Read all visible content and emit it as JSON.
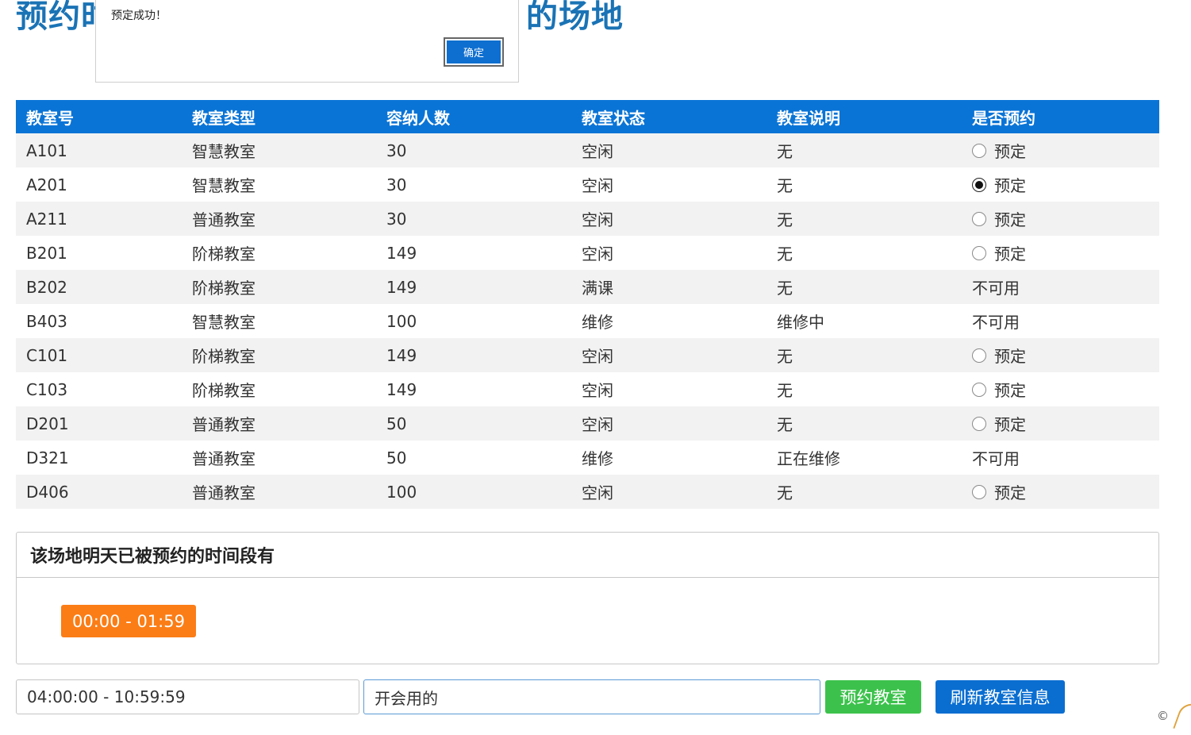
{
  "page": {
    "title_left": "预约时",
    "title_right": "的场地"
  },
  "alert": {
    "message": "预定成功！",
    "ok_label": "确定"
  },
  "table": {
    "headers": [
      "教室号",
      "教室类型",
      "容纳人数",
      "教室状态",
      "教室说明",
      "是否预约"
    ],
    "rows": [
      {
        "room": "A101",
        "type": "智慧教室",
        "capacity": "30",
        "status": "空闲",
        "note": "无",
        "booking": "预定",
        "bookable": true,
        "selected": false
      },
      {
        "room": "A201",
        "type": "智慧教室",
        "capacity": "30",
        "status": "空闲",
        "note": "无",
        "booking": "预定",
        "bookable": true,
        "selected": true
      },
      {
        "room": "A211",
        "type": "普通教室",
        "capacity": "30",
        "status": "空闲",
        "note": "无",
        "booking": "预定",
        "bookable": true,
        "selected": false
      },
      {
        "room": "B201",
        "type": "阶梯教室",
        "capacity": "149",
        "status": "空闲",
        "note": "无",
        "booking": "预定",
        "bookable": true,
        "selected": false
      },
      {
        "room": "B202",
        "type": "阶梯教室",
        "capacity": "149",
        "status": "满课",
        "note": "无",
        "booking": "不可用",
        "bookable": false,
        "selected": false
      },
      {
        "room": "B403",
        "type": "智慧教室",
        "capacity": "100",
        "status": "维修",
        "note": "维修中",
        "booking": "不可用",
        "bookable": false,
        "selected": false
      },
      {
        "room": "C101",
        "type": "阶梯教室",
        "capacity": "149",
        "status": "空闲",
        "note": "无",
        "booking": "预定",
        "bookable": true,
        "selected": false
      },
      {
        "room": "C103",
        "type": "阶梯教室",
        "capacity": "149",
        "status": "空闲",
        "note": "无",
        "booking": "预定",
        "bookable": true,
        "selected": false
      },
      {
        "room": "D201",
        "type": "普通教室",
        "capacity": "50",
        "status": "空闲",
        "note": "无",
        "booking": "预定",
        "bookable": true,
        "selected": false
      },
      {
        "room": "D321",
        "type": "普通教室",
        "capacity": "50",
        "status": "维修",
        "note": "正在维修",
        "booking": "不可用",
        "bookable": false,
        "selected": false
      },
      {
        "room": "D406",
        "type": "普通教室",
        "capacity": "100",
        "status": "空闲",
        "note": "无",
        "booking": "预定",
        "bookable": true,
        "selected": false
      }
    ]
  },
  "booked_panel": {
    "heading": "该场地明天已被预约的时间段有",
    "slots": [
      "00:00 - 01:59"
    ]
  },
  "form": {
    "time_value": "04:00:00 - 10:59:59",
    "note_value": "开会用的",
    "book_label": "预约教室",
    "refresh_label": "刷新教室信息"
  },
  "footer": {
    "copyright_symbol": "©"
  },
  "colors": {
    "title": "#1a73b5",
    "table_header": "#0a74d6",
    "slot_badge": "#fb7d16",
    "book_button": "#3cc24c",
    "refresh_button": "#0a6ed1"
  }
}
